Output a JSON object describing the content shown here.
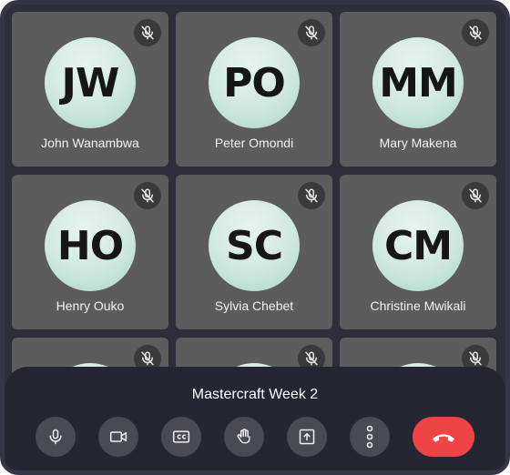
{
  "meeting": {
    "title": "Mastercraft Week 2"
  },
  "participants": [
    {
      "initials": "JW",
      "name": "John Wanambwa",
      "muted": true
    },
    {
      "initials": "PO",
      "name": "Peter Omondi",
      "muted": true
    },
    {
      "initials": "MM",
      "name": "Mary Makena",
      "muted": true
    },
    {
      "initials": "HO",
      "name": "Henry Ouko",
      "muted": true
    },
    {
      "initials": "SC",
      "name": "Sylvia Chebet",
      "muted": true
    },
    {
      "initials": "CM",
      "name": "Christine Mwikali",
      "muted": true
    },
    {
      "initials": "",
      "name": "",
      "muted": true
    },
    {
      "initials": "",
      "name": "",
      "muted": true
    },
    {
      "initials": "",
      "name": "",
      "muted": true
    }
  ],
  "controls": [
    {
      "name": "microphone-button",
      "icon": "microphone-icon"
    },
    {
      "name": "camera-button",
      "icon": "video-camera-icon"
    },
    {
      "name": "captions-button",
      "icon": "closed-captions-icon"
    },
    {
      "name": "raise-hand-button",
      "icon": "hand-icon"
    },
    {
      "name": "share-screen-button",
      "icon": "share-screen-icon"
    },
    {
      "name": "more-options-button",
      "icon": "more-vertical-icon"
    },
    {
      "name": "end-call-button",
      "icon": "phone-hangup-icon"
    }
  ],
  "colors": {
    "background": "#2e2e3b",
    "tile": "#5c5c5c",
    "avatar": "#cfe8df",
    "control": "#4a4a54",
    "end_call": "#ef4444"
  }
}
